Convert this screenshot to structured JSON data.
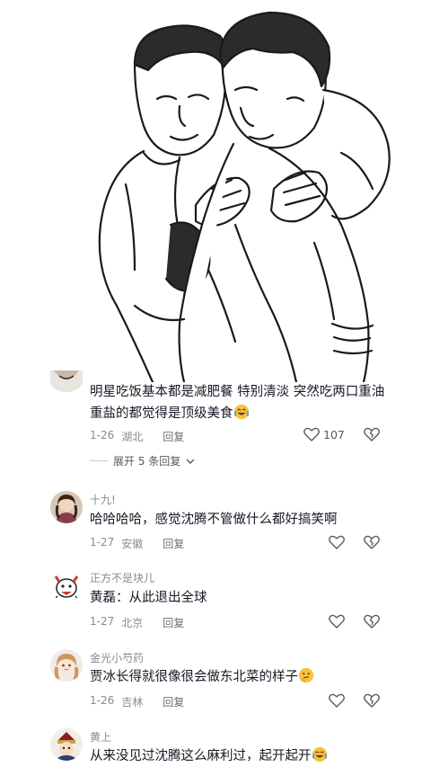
{
  "comments": [
    {
      "username": "",
      "text": "明星吃饭基本都是减肥餐  特别清淡  突然吃两口重油重盐的都觉得是顶级美食",
      "emoji": "laughing-tears-emoji",
      "date": "1-26",
      "location": "湖北",
      "reply_label": "回复",
      "likes": "107",
      "expand_label": "展开 5 条回复"
    },
    {
      "username": "十九!",
      "text": "哈哈哈哈，感觉沈腾不管做什么都好搞笑啊",
      "date": "1-27",
      "location": "安徽",
      "reply_label": "回复"
    },
    {
      "username": "正方不是块儿",
      "text": "黄磊：从此退出全球",
      "date": "1-27",
      "location": "北京",
      "reply_label": "回复"
    },
    {
      "username": "金光小芍药",
      "text": "贾冰长得就很像很会做东北菜的样子",
      "emoji": "thinking-emoji",
      "date": "1-26",
      "location": "吉林",
      "reply_label": "回复"
    },
    {
      "username": "黄上",
      "text": "从来没见过沈腾这么麻利过，起开起开",
      "emoji": "laughing-tears-emoji"
    }
  ],
  "icons": {
    "like": "heart-outline-icon",
    "dislike": "broken-heart-icon",
    "expand": "chevron-down-icon"
  },
  "colors": {
    "text": "#161823",
    "meta": "#8a8b91",
    "emoji_yellow": "#f7c23b"
  }
}
